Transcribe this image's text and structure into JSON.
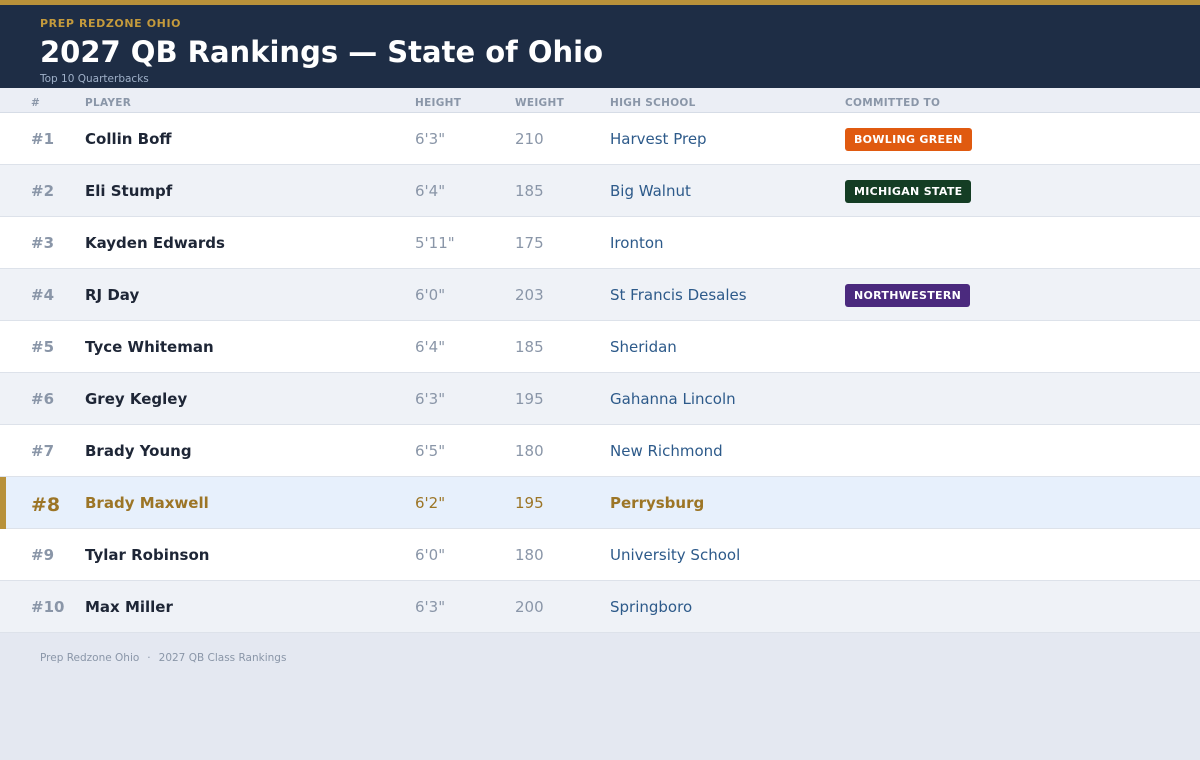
{
  "header": {
    "brand": "PREP REDZONE OHIO",
    "title": "2027 QB Rankings — State of Ohio",
    "subtitle": "Top 10 Quarterbacks",
    "accent_color": "#b8913a",
    "bg_color": "#1e2d45"
  },
  "columns": {
    "rank": "#",
    "player": "PLAYER",
    "height": "HEIGHT",
    "weight": "WEIGHT",
    "school": "HIGH SCHOOL",
    "committed": "COMMITTED TO"
  },
  "rows": [
    {
      "rank": "#1",
      "player": "Collin Boff",
      "height": "6'3\"",
      "weight": "210",
      "school": "Harvest Prep",
      "commit": "BOWLING GREEN",
      "commit_color": "#e05a10"
    },
    {
      "rank": "#2",
      "player": "Eli Stumpf",
      "height": "6'4\"",
      "weight": "185",
      "school": "Big Walnut",
      "commit": "MICHIGAN STATE",
      "commit_color": "#143d24"
    },
    {
      "rank": "#3",
      "player": "Kayden Edwards",
      "height": "5'11\"",
      "weight": "175",
      "school": "Ironton",
      "commit": "",
      "commit_color": ""
    },
    {
      "rank": "#4",
      "player": "RJ Day",
      "height": "6'0\"",
      "weight": "203",
      "school": "St Francis Desales",
      "commit": "NORTHWESTERN",
      "commit_color": "#4b2a7e"
    },
    {
      "rank": "#5",
      "player": "Tyce Whiteman",
      "height": "6'4\"",
      "weight": "185",
      "school": "Sheridan",
      "commit": "",
      "commit_color": ""
    },
    {
      "rank": "#6",
      "player": "Grey Kegley",
      "height": "6'3\"",
      "weight": "195",
      "school": "Gahanna Lincoln",
      "commit": "",
      "commit_color": ""
    },
    {
      "rank": "#7",
      "player": "Brady Young",
      "height": "6'5\"",
      "weight": "180",
      "school": "New Richmond",
      "commit": "",
      "commit_color": ""
    },
    {
      "rank": "#8",
      "player": "Brady Maxwell",
      "height": "6'2\"",
      "weight": "195",
      "school": "Perrysburg",
      "commit": "",
      "commit_color": "",
      "highlighted": true
    },
    {
      "rank": "#9",
      "player": "Tylar Robinson",
      "height": "6'0\"",
      "weight": "180",
      "school": "University School",
      "commit": "",
      "commit_color": ""
    },
    {
      "rank": "#10",
      "player": "Max Miller",
      "height": "6'3\"",
      "weight": "200",
      "school": "Springboro",
      "commit": "",
      "commit_color": ""
    }
  ],
  "footer": {
    "left": "Prep Redzone Ohio",
    "separator": "·",
    "right": "2027 QB Class Rankings"
  }
}
